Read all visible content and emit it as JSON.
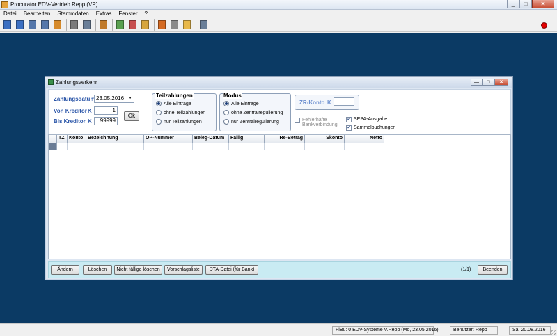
{
  "app": {
    "title": "Procurator EDV-Vertrieb Repp (VP)",
    "winbtns": {
      "minimize": "_",
      "maximize": "□",
      "close": "✕"
    }
  },
  "menu": [
    "Datei",
    "Bearbeiten",
    "Stammdaten",
    "Extras",
    "Fenster",
    "?"
  ],
  "toolbar": {
    "icons": [
      "new-doc-icon",
      "doc-icon",
      "search-doc-icon",
      "print-doc-icon",
      "cabinet-icon",
      "separator",
      "lookup-icon",
      "print-icon",
      "separator",
      "payment-icon",
      "separator",
      "chart-green-icon",
      "chart-red-icon",
      "transfer-icon",
      "separator",
      "bar-chart-icon",
      "pen-icon",
      "deadline-icon",
      "separator",
      "calculator-icon"
    ],
    "colors": [
      "#3b6fc2",
      "#3b6fc2",
      "#5577aa",
      "#5577aa",
      "#d68a2a",
      null,
      "#7a7a7a",
      "#6a7f99",
      null,
      "#c07a2a",
      null,
      "#5aa050",
      "#c85050",
      "#d6a53c",
      null,
      "#d46a22",
      "#8a8a8a",
      "#e8b84a",
      null,
      "#6a7f99"
    ],
    "record_color": "#e00000"
  },
  "child": {
    "title": "Zahlungsverkehr",
    "winbtns": {
      "minimize": "—",
      "maximize": "□",
      "close": "✕"
    },
    "form": {
      "zahlungsdatum_label": "Zahlungsdatum",
      "zahlungsdatum_value": "23.05.2016",
      "dropdown_arrow": "▼",
      "von_kreditor_label": "Von Kreditor",
      "von_kreditor_prefix": "K",
      "von_kreditor_value": "1",
      "bis_kreditor_label": "Bis Kreditor",
      "bis_kreditor_prefix": "K",
      "bis_kreditor_value": "99999",
      "ok_label": "Ok"
    },
    "teilzahlungen": {
      "title": "Teilzahlungen",
      "options": [
        "Alle Einträge",
        "ohne Teilzahlungen",
        "nur Teilzahlungen"
      ],
      "selected": 0
    },
    "modus": {
      "title": "Modus",
      "options": [
        "Alle Einträge",
        "ohne Zentralregulierung",
        "nur Zentralregulierung"
      ],
      "selected": 0
    },
    "zr_konto": {
      "label": "ZR-Konto",
      "prefix": "K",
      "value": ""
    },
    "checks": {
      "fehlerhafte_line1": "Fehlerhafte",
      "fehlerhafte_line2": "Bankverbindung",
      "fehlerhafte_checked": false,
      "sepa": "SEPA-Ausgabe",
      "sepa_checked": true,
      "sammel": "Sammelbuchungen",
      "sammel_checked": true
    },
    "grid": {
      "columns": [
        {
          "label": "",
          "align": "left"
        },
        {
          "label": "TZ",
          "align": "left"
        },
        {
          "label": "Konto",
          "align": "left"
        },
        {
          "label": "Bezeichnung",
          "align": "left"
        },
        {
          "label": "OP-Nummer",
          "align": "left"
        },
        {
          "label": "Beleg-Datum",
          "align": "left"
        },
        {
          "label": "Fällig",
          "align": "left"
        },
        {
          "label": "Re-Betrag",
          "align": "right"
        },
        {
          "label": "Skonto",
          "align": "right"
        },
        {
          "label": "Netto",
          "align": "right"
        }
      ]
    },
    "buttons": {
      "aendern": "Ändern",
      "loeschen": "Löschen",
      "nicht_faellige": "Nicht fällige löschen",
      "vorschlagsliste": "Vorschlagsliste",
      "dta": "DTA-Datei (für Bank)",
      "page": "(1/1)",
      "beenden": "Beenden"
    }
  },
  "status": {
    "fibu": "FiBu: 0 EDV-Systeme V.Repp (Mo, 23.05.2016)",
    "benutzer": "Benutzer: Repp",
    "datum": "Sa, 20.08.2016"
  }
}
